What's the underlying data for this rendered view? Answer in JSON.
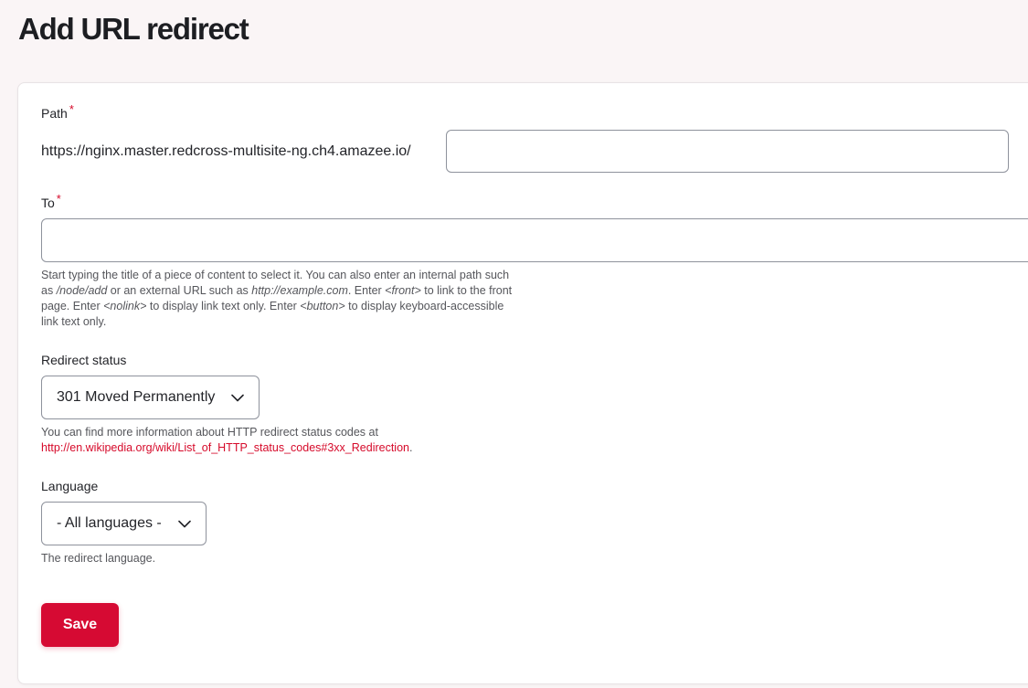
{
  "page": {
    "title": "Add URL redirect"
  },
  "form": {
    "path": {
      "label": "Path",
      "required_marker": "*",
      "prefix": "https://nginx.master.redcross-multisite-ng.ch4.amazee.io/",
      "value": "",
      "placeholder": ""
    },
    "to": {
      "label": "To",
      "required_marker": "*",
      "value": "",
      "placeholder": "",
      "help": {
        "p1": "Start typing the title of a piece of content to select it. You can also enter an internal path such as ",
        "e1": "/node/add",
        "p2": " or an external URL such as ",
        "e2": "http://example.com",
        "p3": ". Enter ",
        "e3": "<front>",
        "p4": " to link to the front page. Enter ",
        "e4": "<nolink>",
        "p5": " to display link text only. Enter ",
        "e5": "<button>",
        "p6": " to display keyboard-accessible link text only."
      }
    },
    "redirect_status": {
      "label": "Redirect status",
      "selected": "301 Moved Permanently",
      "help_text": "You can find more information about HTTP redirect status codes at",
      "help_link": "http://en.wikipedia.org/wiki/List_of_HTTP_status_codes#3xx_Redirection",
      "help_suffix": "."
    },
    "language": {
      "label": "Language",
      "selected": "- All languages -",
      "help": "The redirect language."
    },
    "save_label": "Save"
  },
  "colors": {
    "accent": "#d60a33",
    "background": "#faf5f6",
    "card": "#ffffff"
  },
  "icons": {
    "select_chevron": "chevron-down-icon"
  }
}
